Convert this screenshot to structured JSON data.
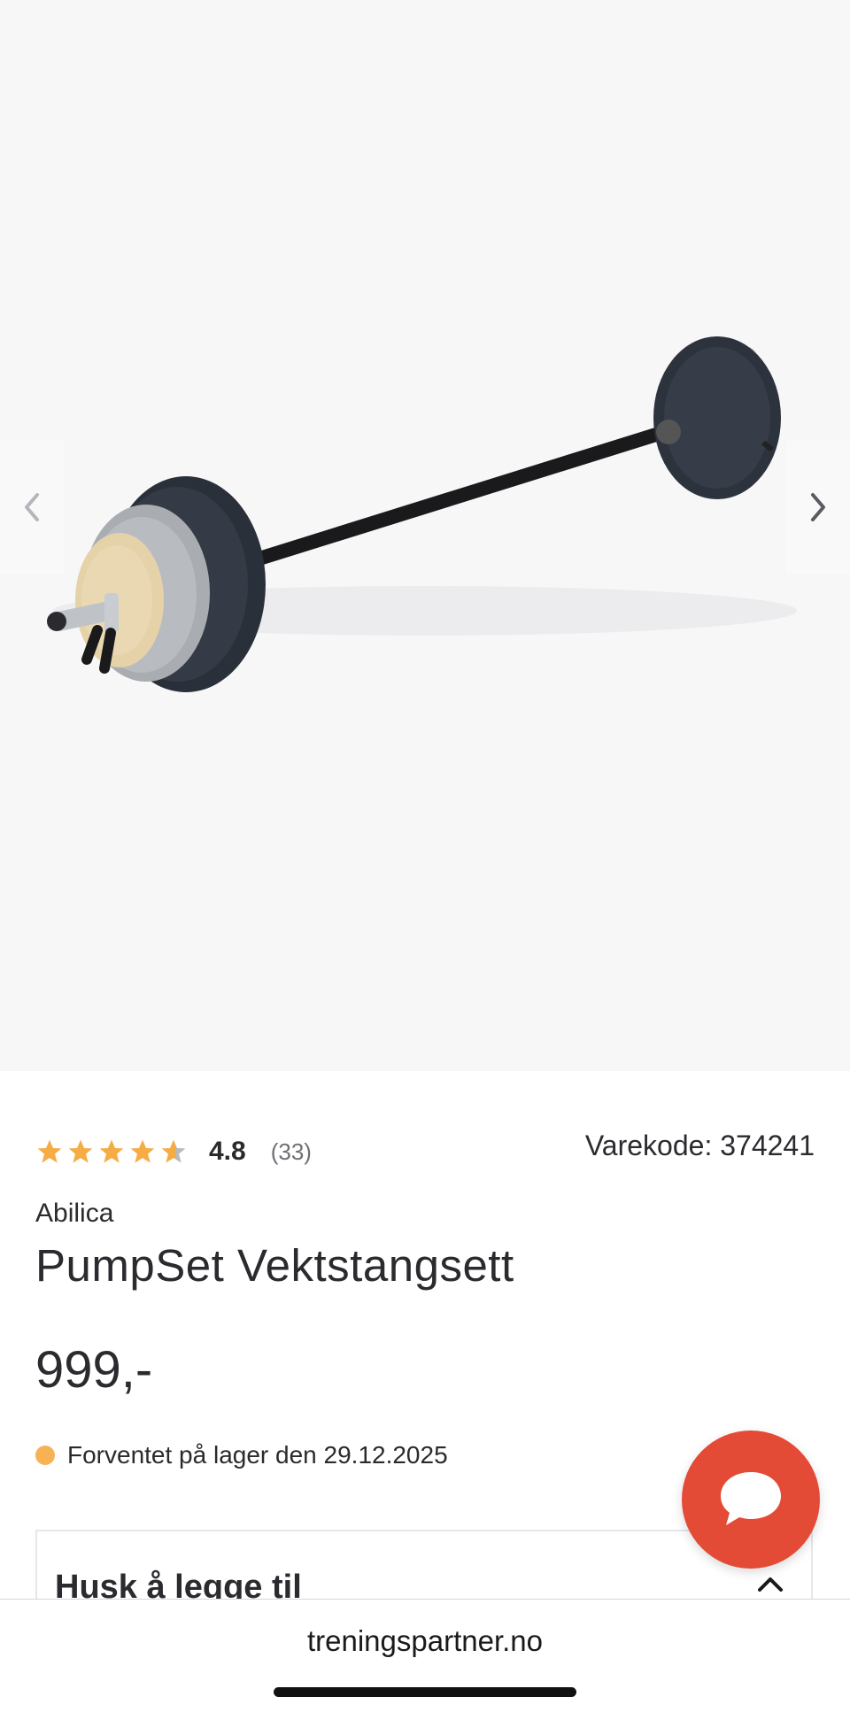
{
  "gallery": {
    "image_alt": "PumpSet Vektstangsett",
    "prev_icon": "chevron-left-icon",
    "next_icon": "chevron-right-icon"
  },
  "product": {
    "rating": 4.8,
    "rating_label": "4.8",
    "review_count": "(33)",
    "sku_label": "Varekode: 374241",
    "brand": "Abilica",
    "title": "PumpSet Vektstangsett",
    "price": "999,-",
    "stock_status": "Forventet på lager den 29.12.2025",
    "stock_color": "#f7b255",
    "star_color": "#f5ac44"
  },
  "addons": {
    "title": "Husk å legge til",
    "chevron_icon": "chevron-up-icon"
  },
  "chat": {
    "icon": "chat-bubble-icon",
    "color": "#e44b36"
  },
  "browser": {
    "url": "treningspartner.no"
  }
}
